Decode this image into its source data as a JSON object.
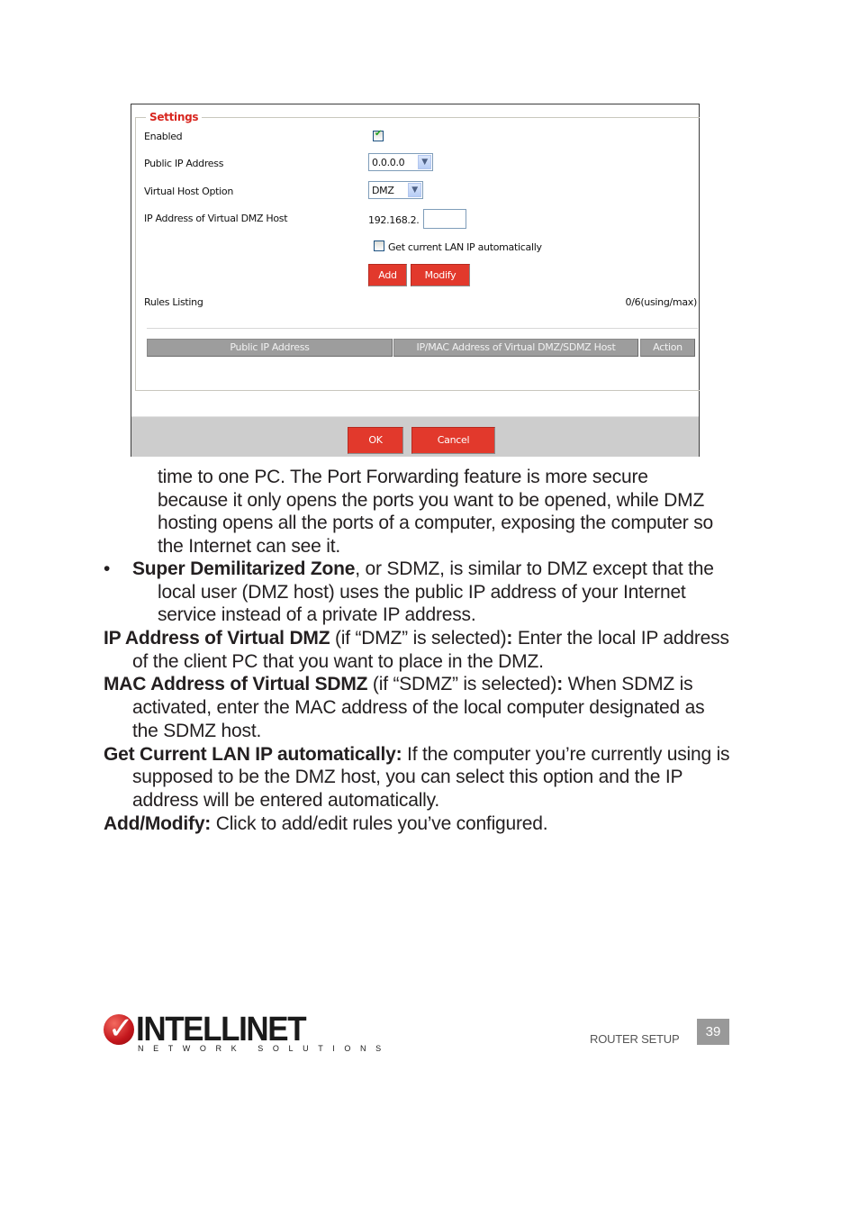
{
  "router_ui": {
    "settings_legend": "Settings",
    "fields": {
      "enabled": {
        "label": "Enabled",
        "checked": true
      },
      "public_ip": {
        "label": "Public IP Address",
        "selected": "0.0.0.0"
      },
      "virtual_host_option": {
        "label": "Virtual Host Option",
        "selected": "DMZ"
      },
      "dmz_host_ip": {
        "label": "IP Address of Virtual DMZ Host",
        "prefix": "192.168.2.",
        "value": ""
      },
      "get_lan_ip": {
        "label": "Get current LAN IP automatically",
        "checked": false
      }
    },
    "buttons": {
      "add": "Add",
      "modify": "Modify",
      "ok": "OK",
      "cancel": "Cancel"
    },
    "rules_listing": {
      "label": "Rules Listing",
      "count": "0/6(using/max)",
      "columns": [
        "Public IP Address",
        "IP/MAC Address of Virtual DMZ/SDMZ Host",
        "Action"
      ],
      "rows": []
    }
  },
  "body": {
    "continuation": "time to one PC. The Port Forwarding feature is more secure because it only opens the ports you want to be opened, while DMZ hosting opens all the ports of a computer, exposing the computer so the Internet can see it.",
    "bullet_marker": "•",
    "sdmz_term": "Super Demilitarized Zone",
    "sdmz_text": ", or SDMZ, is similar to DMZ except that the local user (DMZ host) uses the public IP address of your Internet service instead of a private IP address.",
    "items": [
      {
        "term": "IP Address of Virtual DMZ",
        "qualifier": " (if “DMZ” is selected)",
        "colon": ":",
        "text": " Enter the local IP address of the client PC that you want to place in the DMZ."
      },
      {
        "term": "MAC Address of Virtual SDMZ",
        "qualifier": " (if “SDMZ” is selected)",
        "colon": ":",
        "text": " When SDMZ is activated, enter the MAC address of the local computer designated as the SDMZ host."
      },
      {
        "term": "Get Current LAN IP automatically:",
        "qualifier": "",
        "colon": "",
        "text": " If the computer you’re currently using is supposed to be the DMZ host, you can select this option and the IP address will be entered automatically."
      },
      {
        "term": "Add/Modify:",
        "qualifier": "",
        "colon": "",
        "text": " Click to add/edit rules you’ve configured."
      }
    ]
  },
  "footer": {
    "brand": "INTELLINET",
    "tagline": "NETWORK SOLUTIONS",
    "section": "ROUTER SETUP",
    "page_number": "39"
  }
}
